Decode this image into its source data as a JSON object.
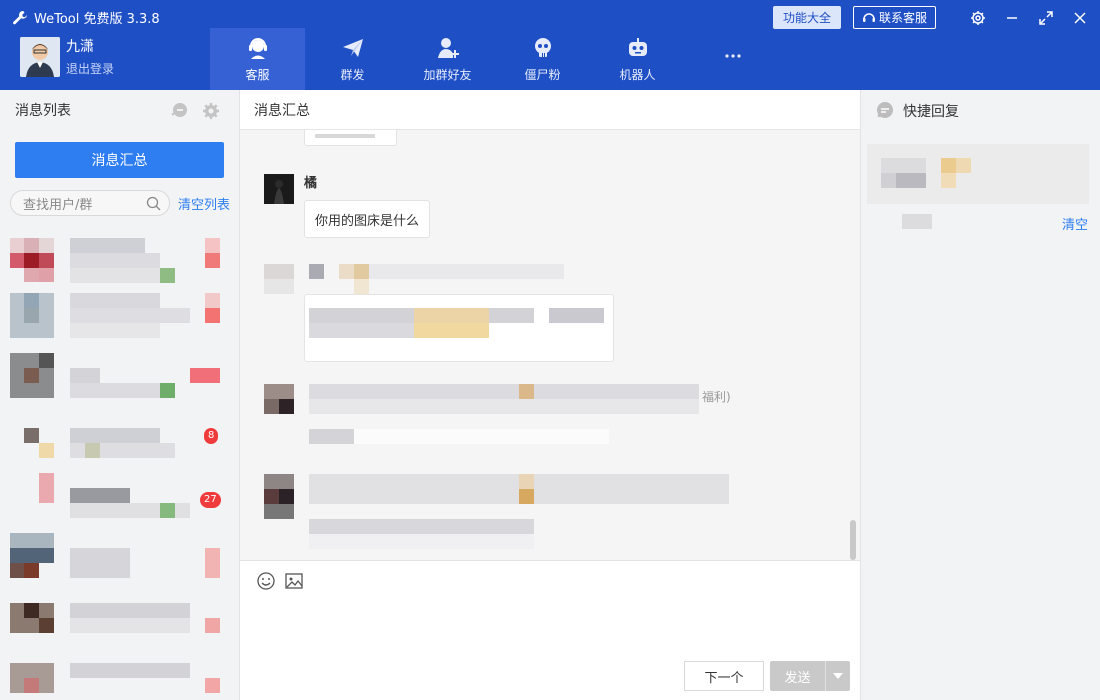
{
  "app": {
    "title": "WeTool 免费版 3.3.8",
    "feature_btn": "功能大全",
    "contact_btn": "联系客服"
  },
  "profile": {
    "name": "九潇",
    "logout": "退出登录"
  },
  "nav": [
    {
      "label": "客服",
      "icon": "customer-service-icon",
      "active": true
    },
    {
      "label": "群发",
      "icon": "send-plane-icon",
      "active": false
    },
    {
      "label": "加群好友",
      "icon": "add-friend-icon",
      "active": false
    },
    {
      "label": "僵尸粉",
      "icon": "skull-icon",
      "active": false
    },
    {
      "label": "机器人",
      "icon": "robot-icon",
      "active": false
    },
    {
      "label": "",
      "icon": "more-icon",
      "active": false
    }
  ],
  "left": {
    "title": "消息列表",
    "summary_btn": "消息汇总",
    "search_placeholder": "查找用户/群",
    "clear_list": "清空列表",
    "badges": [
      "8",
      "27"
    ]
  },
  "center": {
    "title": "消息汇总",
    "messages": [
      {
        "sender": "橘",
        "text": "你用的图床是什么"
      }
    ],
    "partial_text": "福利)",
    "next_btn": "下一个",
    "send_btn": "发送"
  },
  "right": {
    "title": "快捷回复",
    "clear": "清空"
  },
  "colors": {
    "header": "#1f4fc4",
    "accent": "#2e7ef2",
    "badge": "#ef3b3b"
  }
}
